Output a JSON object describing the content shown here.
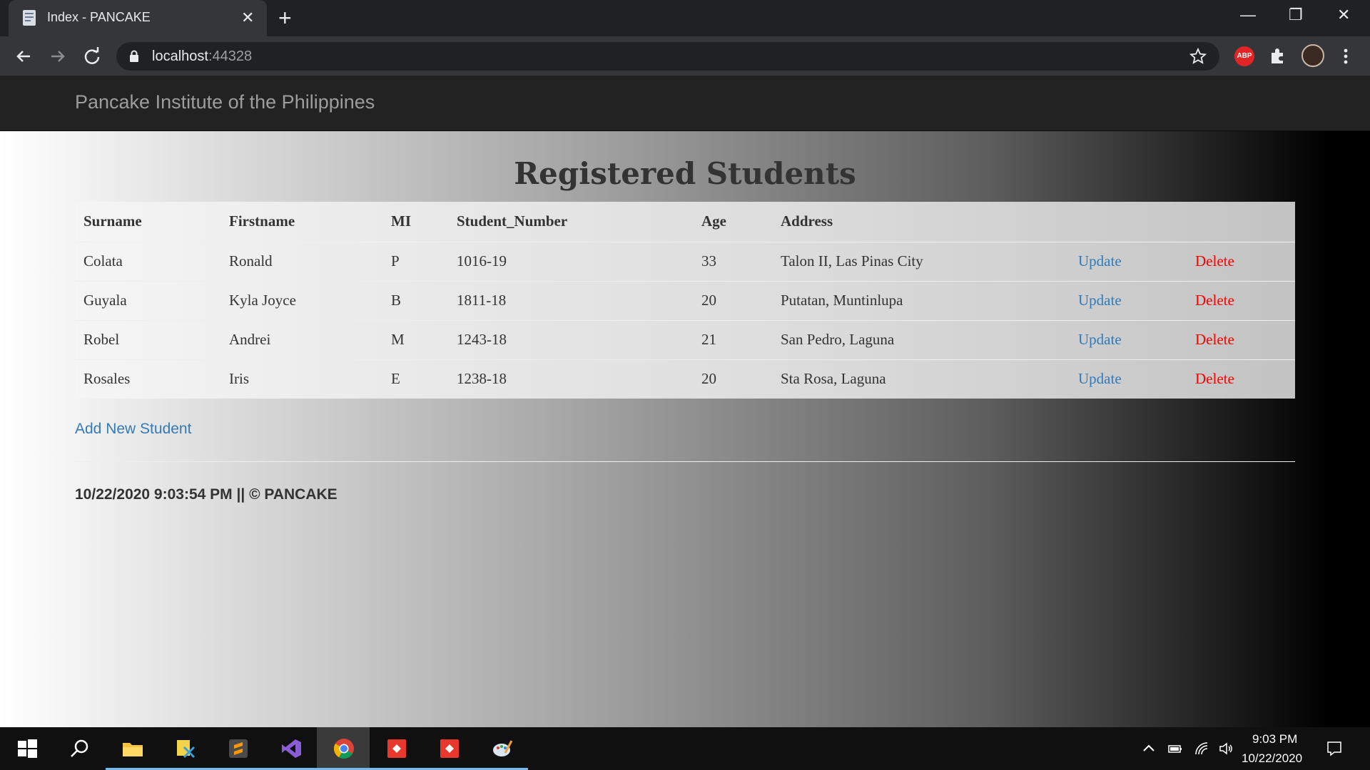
{
  "browser": {
    "tab_title": "Index - PANCAKE",
    "tab_close": "✕",
    "new_tab": "+",
    "url_host": "localhost",
    "url_port": ":44328",
    "window_controls": {
      "minimize": "—",
      "restore": "❐",
      "close": "✕"
    }
  },
  "navbar": {
    "brand": "Pancake Institute of the Philippines"
  },
  "main": {
    "heading": "Registered Students",
    "columns": [
      "Surname",
      "Firstname",
      "MI",
      "Student_Number",
      "Age",
      "Address"
    ],
    "rows": [
      {
        "surname": "Colata",
        "firstname": "Ronald",
        "mi": "P",
        "student_number": "1016-19",
        "age": "33",
        "address": "Talon II, Las Pinas City",
        "update": "Update",
        "delete": "Delete"
      },
      {
        "surname": "Guyala",
        "firstname": "Kyla Joyce",
        "mi": "B",
        "student_number": "1811-18",
        "age": "20",
        "address": "Putatan, Muntinlupa",
        "update": "Update",
        "delete": "Delete"
      },
      {
        "surname": "Robel",
        "firstname": "Andrei",
        "mi": "M",
        "student_number": "1243-18",
        "age": "21",
        "address": "San Pedro, Laguna",
        "update": "Update",
        "delete": "Delete"
      },
      {
        "surname": "Rosales",
        "firstname": "Iris",
        "mi": "E",
        "student_number": "1238-18",
        "age": "20",
        "address": "Sta Rosa, Laguna",
        "update": "Update",
        "delete": "Delete"
      }
    ],
    "add_link": "Add New Student",
    "footer": "10/22/2020 9:03:54 PM || © PANCAKE"
  },
  "taskbar": {
    "apps": [
      "windows-start",
      "search",
      "file-explorer",
      "sql-tool",
      "sublime-text",
      "visual-studio",
      "chrome",
      "git-client-1",
      "git-client-2",
      "paint"
    ],
    "time": "9:03 PM",
    "date": "10/22/2020"
  },
  "colors": {
    "link": "#337ab7",
    "delete": "#ff0000",
    "navbar": "#222222"
  }
}
